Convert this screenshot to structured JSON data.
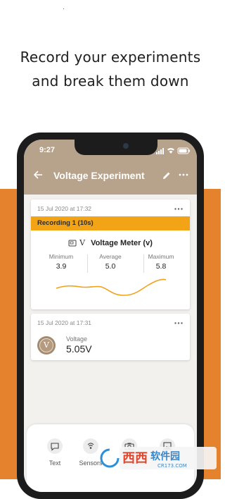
{
  "promo": {
    "headline_line1": "Record your experiments",
    "headline_line2": "and break them down"
  },
  "status_bar": {
    "time": "9:27"
  },
  "app_bar": {
    "title": "Voltage Experiment"
  },
  "card1": {
    "date": "15 Jul 2020 at 17:32",
    "recording_label": "Recording 1 (10s)",
    "sensor_symbol": "V",
    "sensor_name": "Voltage Meter (v)",
    "stats": [
      {
        "label": "Minimum",
        "value": "3.9"
      },
      {
        "label": "Average",
        "value": "5.0"
      },
      {
        "label": "Maximum",
        "value": "5.8"
      }
    ]
  },
  "card2": {
    "date": "15 Jul 2020 at 17:31",
    "avatar_symbol": "V",
    "label": "Voltage",
    "value": "5.05V"
  },
  "bottom_tabs": [
    {
      "label": "Text",
      "icon": "chat-bubble-icon"
    },
    {
      "label": "Sensors",
      "icon": "sensor-icon"
    },
    {
      "label": "",
      "icon": "camera-icon"
    },
    {
      "label": "",
      "icon": "gallery-icon"
    }
  ],
  "watermark": {
    "text_main": "西西软件园",
    "text_sub": "CR173.COM"
  },
  "colors": {
    "orange": "#e5822d",
    "appbar": "#b7a38c",
    "recording": "#f3a416",
    "line": "#f0a21a"
  }
}
